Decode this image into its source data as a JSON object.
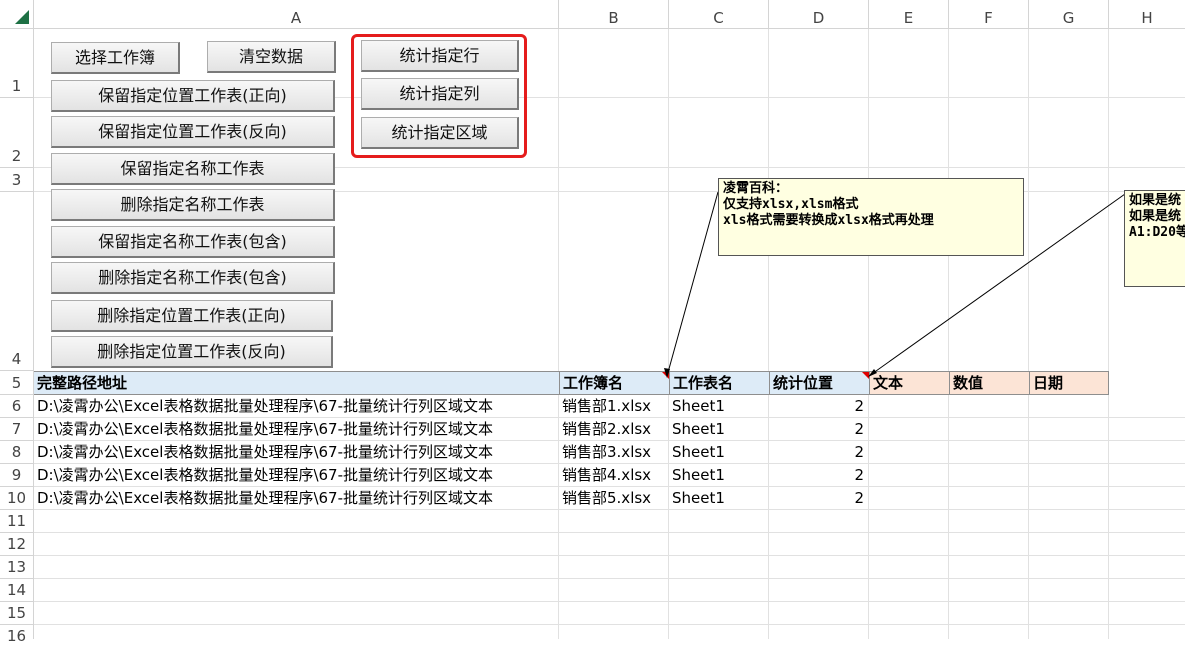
{
  "columns": [
    "A",
    "B",
    "C",
    "D",
    "E",
    "F",
    "G",
    "H"
  ],
  "rows": [
    "1",
    "2",
    "3",
    "4",
    "5",
    "6",
    "7",
    "8",
    "9",
    "10",
    "11",
    "12",
    "13",
    "14",
    "15",
    "16"
  ],
  "buttons": {
    "select_workbook": "选择工作簿",
    "clear_data": "清空数据",
    "keep_pos_forward": "保留指定位置工作表(正向)",
    "keep_pos_reverse": "保留指定位置工作表(反向)",
    "keep_name": "保留指定名称工作表",
    "delete_name": "删除指定名称工作表",
    "keep_name_contains": "保留指定名称工作表(包含)",
    "delete_name_contains": "删除指定名称工作表(包含)",
    "delete_pos_forward": "删除指定位置工作表(正向)",
    "delete_pos_reverse": "删除指定位置工作表(反向)",
    "count_rows": "统计指定行",
    "count_cols": "统计指定列",
    "count_range": "统计指定区域"
  },
  "headers": {
    "full_path": "完整路径地址",
    "workbook_name": "工作簿名",
    "sheet_name": "工作表名",
    "stat_position": "统计位置",
    "text": "文本",
    "numeric": "数值",
    "date": "日期"
  },
  "table": [
    {
      "path": "D:\\凌霄办公\\Excel表格数据批量处理程序\\67-批量统计行列区域文本",
      "workbook": "销售部1.xlsx",
      "sheet": "Sheet1",
      "pos": "2"
    },
    {
      "path": "D:\\凌霄办公\\Excel表格数据批量处理程序\\67-批量统计行列区域文本",
      "workbook": "销售部2.xlsx",
      "sheet": "Sheet1",
      "pos": "2"
    },
    {
      "path": "D:\\凌霄办公\\Excel表格数据批量处理程序\\67-批量统计行列区域文本",
      "workbook": "销售部3.xlsx",
      "sheet": "Sheet1",
      "pos": "2"
    },
    {
      "path": "D:\\凌霄办公\\Excel表格数据批量处理程序\\67-批量统计行列区域文本",
      "workbook": "销售部4.xlsx",
      "sheet": "Sheet1",
      "pos": "2"
    },
    {
      "path": "D:\\凌霄办公\\Excel表格数据批量处理程序\\67-批量统计行列区域文本",
      "workbook": "销售部5.xlsx",
      "sheet": "Sheet1",
      "pos": "2"
    }
  ],
  "comments": {
    "note1": [
      "凌霄百科：",
      "仅支持xlsx,xlsm格式",
      "xls格式需要转换成xlsx格式再处理"
    ],
    "note2": [
      "如果是统",
      "如果是统",
      "A1:D20等"
    ]
  },
  "colors": {
    "accent_red": "#e51c1c",
    "header_blue": "#ddebf7",
    "header_pink": "#fce4d6",
    "note_bg": "#ffffe1",
    "corner_green": "#1e7145"
  }
}
